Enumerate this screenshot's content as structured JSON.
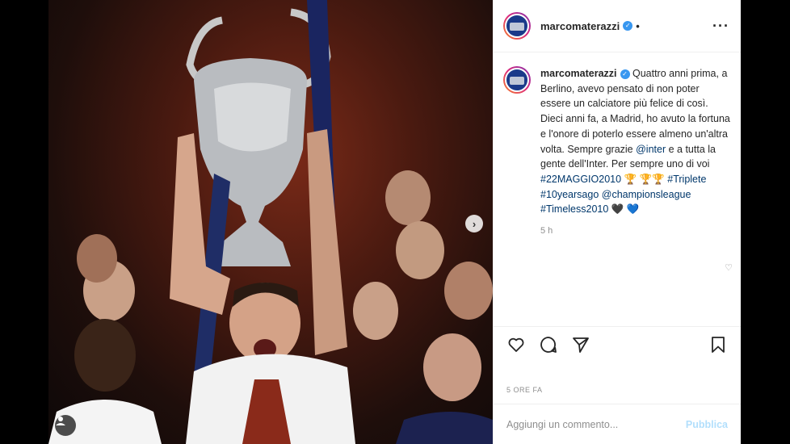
{
  "post": {
    "username": "marcomaterazzi",
    "verified_icon": "verified-badge-icon",
    "more_icon": "more-options-icon",
    "caption_user": "marcomaterazzi",
    "caption_text_1": "Quattro anni prima, a Berlino, avevo pensato di non poter essere un calciatore più felice di così. Dieci anni fa, a Madrid, ho avuto la fortuna e l'onore di poterlo essere almeno un'altra volta. Sempre grazie ",
    "mention_inter": "@inter",
    "caption_text_2": " e a tutta la gente dell'Inter. Per sempre uno di voi ",
    "tag_1": "#22MAGGIO2010",
    "emoji_trophy": "🏆",
    "tag_2": "#Triplete",
    "tag_3": "#10yearsago",
    "mention_cl": "@championsleague",
    "tag_4": "#Timeless2010",
    "emoji_black_heart": "🖤",
    "emoji_blue_heart": "💙",
    "time_ago": "5 h",
    "date": "5 ORE FA",
    "comment_placeholder": "Aggiungi un commento...",
    "publish_label": "Pubblica"
  },
  "colors": {
    "link": "#00376b",
    "verified": "#3897f0",
    "publish": "#b2dffc"
  }
}
